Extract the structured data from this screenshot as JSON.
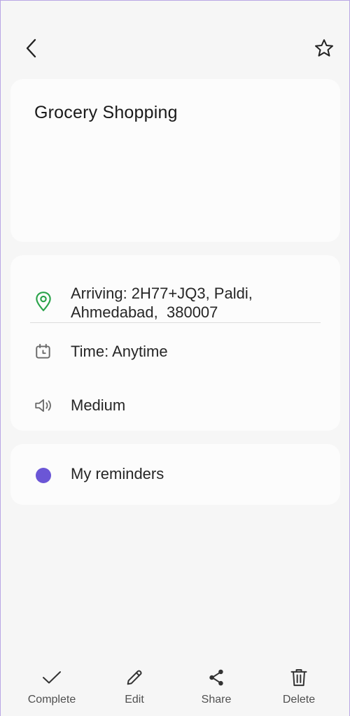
{
  "header": {
    "back_icon": "chevron-left-icon",
    "favorite_icon": "star-outline-icon"
  },
  "reminder": {
    "title": "Grocery Shopping"
  },
  "details": {
    "location_icon": "location-pin-icon",
    "location_line1": "Arriving: 2H77+JQ3, Paldi,",
    "location_line2": "Ahmedabad,  380007",
    "time_icon": "calendar-clock-icon",
    "time": "Time: Anytime",
    "priority_icon": "speaker-icon",
    "priority": "Medium"
  },
  "list": {
    "name": "My reminders",
    "color": "#6b56d6"
  },
  "actions": {
    "complete": "Complete",
    "edit": "Edit",
    "share": "Share",
    "delete": "Delete"
  },
  "colors": {
    "location_accent": "#2aa34a",
    "background": "#f6f6f6",
    "card": "#fcfcfc"
  }
}
